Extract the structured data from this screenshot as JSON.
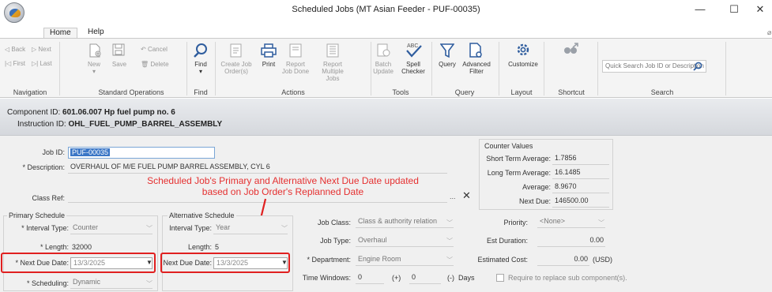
{
  "window": {
    "title": "Scheduled Jobs (MT Asian Feeder - PUF-00035)",
    "minimize": "—",
    "maximize": "☐",
    "close": "✕"
  },
  "menu": {
    "home": "Home",
    "help": "Help"
  },
  "ribbon": {
    "navigation": {
      "back": "Back",
      "next": "Next",
      "first": "First",
      "last": "Last",
      "group": "Navigation"
    },
    "standard": {
      "new": "New",
      "save": "Save",
      "cancel": "Cancel",
      "delete": "Delete",
      "group": "Standard Operations"
    },
    "find": {
      "find": "Find",
      "group": "Find"
    },
    "actions": {
      "create_job": "Create Job Order(s)",
      "print": "Print",
      "report_done": "Report Job Done",
      "report_multiple": "Report Multiple Jobs",
      "group": "Actions"
    },
    "tools": {
      "batch_update": "Batch Update",
      "spell_checker": "Spell Checker",
      "group": "Tools"
    },
    "query": {
      "query": "Query",
      "advanced_filter": "Advanced Filter",
      "group": "Query"
    },
    "layout": {
      "customize": "Customize",
      "group": "Layout"
    },
    "shortcut": {
      "group": "Shortcut"
    },
    "search": {
      "placeholder": "Quick Search Job ID or Description",
      "group": "Search"
    }
  },
  "info": {
    "component_label": "Component ID:",
    "component_value": "601.06.007 Hp fuel pump no. 6",
    "instruction_label": "Instruction ID:",
    "instruction_value": "OHL_FUEL_PUMP_BARREL_ASSEMBLY"
  },
  "form": {
    "job_id_label": "Job ID:",
    "job_id": "PUF-00035",
    "description_label": "* Description:",
    "description": "OVERHAUL OF M/E FUEL PUMP BARREL ASSEMBLY, CYL 6",
    "class_ref_label": "Class Ref:",
    "more": "...",
    "clear": "✕"
  },
  "counter": {
    "title": "Counter Values",
    "short_label": "Short Term Average:",
    "short_value": "1.7856",
    "long_label": "Long Term Average:",
    "long_value": "16.1485",
    "avg_label": "Average:",
    "avg_value": "8.9670",
    "next_label": "Next Due:",
    "next_value": "146500.00"
  },
  "annotation": {
    "line1": "Scheduled Job's Primary and Alternative Next Due Date updated",
    "line2": "based on Job Order's Replanned Date"
  },
  "primary": {
    "title": "Primary Schedule",
    "interval_type_label": "* Interval Type:",
    "interval_type": "Counter",
    "length_label": "* Length:",
    "length": "32000",
    "next_due_label": "* Next Due Date:",
    "next_due": "13/3/2025",
    "scheduling_label": "* Scheduling:",
    "scheduling": "Dynamic"
  },
  "alternative": {
    "title": "Alternative Schedule",
    "interval_type_label": "Interval Type:",
    "interval_type": "Year",
    "length_label": "Length:",
    "length": "5",
    "next_due_label": "Next Due Date:",
    "next_due": "13/3/2025"
  },
  "job": {
    "class_label": "Job Class:",
    "class": "Class & authority relation",
    "type_label": "Job Type:",
    "type": "Overhaul",
    "dept_label": "* Department:",
    "dept": "Engine Room",
    "windows_label": "Time Windows:",
    "win_minus": "0",
    "win_plus_sign": "(+)",
    "win_plus": "0",
    "win_minus_sign": "(-)",
    "days": "Days"
  },
  "right": {
    "priority_label": "Priority:",
    "priority": "<None>",
    "duration_label": "Est Duration:",
    "duration": "0.00",
    "cost_label": "Estimated Cost:",
    "cost": "0.00",
    "currency": "(USD)",
    "require_label": "Require to replace sub component(s)."
  }
}
